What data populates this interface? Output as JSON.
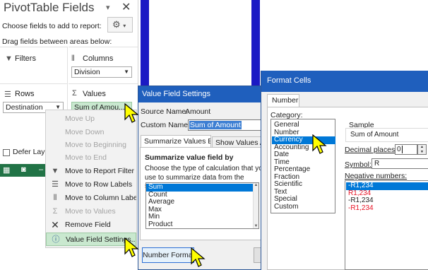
{
  "pivot_pane": {
    "title": "PivotTable Fields",
    "choose_label": "Choose fields to add to report:",
    "drag_label": "Drag fields between areas below:",
    "filters_label": "Filters",
    "columns_label": "Columns",
    "columns_field": "Division",
    "rows_label": "Rows",
    "rows_field": "Destination",
    "values_label": "Values",
    "values_field": "Sum of Amou...",
    "defer_label": "Defer Layo"
  },
  "context_menu": {
    "items": [
      {
        "label": "Move Up",
        "enabled": false
      },
      {
        "label": "Move Down",
        "enabled": false
      },
      {
        "label": "Move to Beginning",
        "enabled": false
      },
      {
        "label": "Move to End",
        "enabled": false
      },
      {
        "label": "Move to Report Filter",
        "enabled": true
      },
      {
        "label": "Move to Row Labels",
        "enabled": true
      },
      {
        "label": "Move to Column Labels",
        "enabled": true
      },
      {
        "label": "Move to Values",
        "enabled": false
      },
      {
        "label": "Remove Field",
        "enabled": true
      },
      {
        "label": "Value Field Settings...",
        "enabled": true,
        "highlighted": true
      }
    ]
  },
  "value_field_settings": {
    "title": "Value Field Settings",
    "source_label": "Source Name:",
    "source_value": "Amount",
    "custom_label": "Custom Name:",
    "custom_value": "Sum of Amount",
    "tab_summarize": "Summarize Values By",
    "tab_show": "Show Values As",
    "section_title": "Summarize value field by",
    "instructions": "Choose the type of calculation that you use to summarize data from the selected field",
    "functions": [
      "Sum",
      "Count",
      "Average",
      "Max",
      "Min",
      "Product"
    ],
    "selected_function": "Sum",
    "number_format_button": "Number Format"
  },
  "format_cells": {
    "title": "Format Cells",
    "tab_number": "Number",
    "category_label": "Category:",
    "categories": [
      "General",
      "Number",
      "Currency",
      "Accounting",
      "Date",
      "Time",
      "Percentage",
      "Fraction",
      "Scientific",
      "Text",
      "Special",
      "Custom"
    ],
    "selected_category": "Currency",
    "sample_label": "Sample",
    "sample_value": "Sum of Amount",
    "decimal_label": "Decimal places:",
    "decimal_value": "0",
    "symbol_label": "Symbol:",
    "symbol_value": "R",
    "negative_label": "Negative numbers:",
    "negative_numbers": [
      {
        "text": "-R1,234",
        "red": false,
        "selected": true
      },
      {
        "text": "R1,234",
        "red": true,
        "selected": false
      },
      {
        "text": "-R1,234",
        "red": false,
        "selected": false
      },
      {
        "text": "-R1,234",
        "red": true,
        "selected": false
      }
    ]
  },
  "colors": {
    "excel_green": "#217346",
    "title_blue": "#1f5fbd",
    "stripe_blue": "#1b1ac4",
    "highlight_green": "#c9e8cf",
    "selection_blue": "#0078d7",
    "negative_red": "#e81123",
    "cursor_yellow": "#ffff00"
  }
}
